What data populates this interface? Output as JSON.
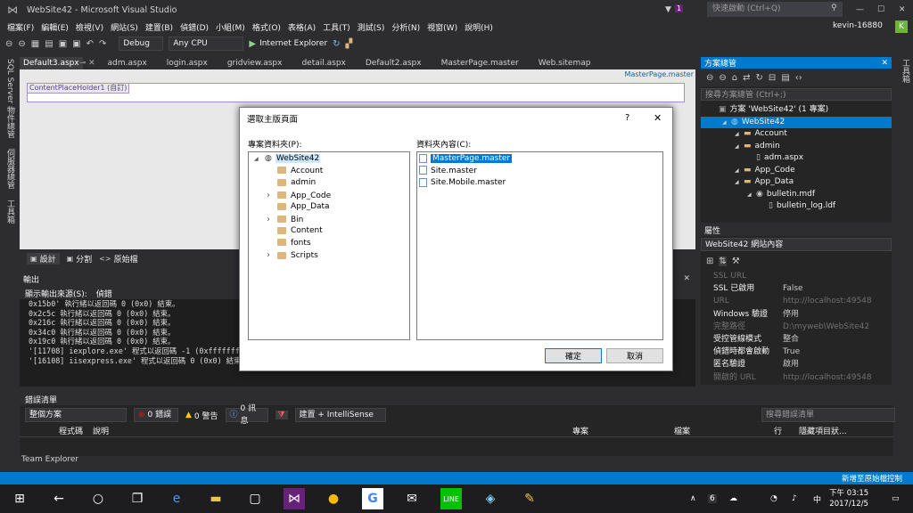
{
  "window": {
    "title": "WebSite42 - Microsoft Visual Studio",
    "notif_count": "1",
    "quick_launch": "快速啟動 (Ctrl+Q)",
    "user": "kevin-16880",
    "avatar_letter": "K"
  },
  "menu": [
    "檔案(F)",
    "編輯(E)",
    "檢視(V)",
    "網站(S)",
    "建置(B)",
    "偵錯(D)",
    "小組(M)",
    "格式(O)",
    "表格(A)",
    "工具(T)",
    "測試(S)",
    "分析(N)",
    "視窗(W)",
    "說明(H)"
  ],
  "toolbar": {
    "config": "Debug",
    "platform": "Any CPU",
    "run_target": "Internet Explorer"
  },
  "left_tabs": [
    "SQL Server 物件總管",
    "伺服器總管",
    "工具箱"
  ],
  "right_tab": "工具箱",
  "doc_tabs": [
    "Default3.aspx",
    "adm.aspx",
    "login.aspx",
    "gridview.aspx",
    "detail.aspx",
    "Default2.aspx",
    "MasterPage.master",
    "Web.sitemap"
  ],
  "editor": {
    "master_label": "MasterPage.master",
    "placeholder_label": "ContentPlaceHolder1 (自訂)"
  },
  "design_tabs": [
    "設計",
    "分割",
    "原始檔"
  ],
  "output": {
    "title": "輸出",
    "source_label": "顯示輸出來源(S):",
    "source_value": "偵錯",
    "lines": [
      "0x15b0' 執行緒以返回碼 0 (0x0) 結束。",
      "0x2c5c 執行緒以返回碼 0 (0x0) 結束。",
      "0x216c 執行緒以返回碼 0 (0x0) 結束。",
      "0x34c0 執行緒以返回碼 0 (0x0) 結束。",
      "0x19c0 執行緒以返回碼 0 (0x0) 結束。",
      "'[11708] iexplore.exe' 程式以返回碼 -1 (0xffffffff) 結",
      "'[16108] iisexpress.exe' 程式以返回碼 0 (0x0) 結束。"
    ]
  },
  "errors": {
    "title": "錯誤清單",
    "scope": "整個方案",
    "errors": "0 錯誤",
    "warnings": "0 警告",
    "messages": "0 訊息",
    "build": "建置 + IntelliSense",
    "search": "搜尋錯誤清單",
    "cols": [
      "程式碼",
      "說明",
      "專案",
      "檔案",
      "行",
      "隱藏項目狀..."
    ]
  },
  "team_explorer": "Team Explorer",
  "status": {
    "right": "新增至原始檔控制"
  },
  "solution": {
    "title": "方案總管",
    "search": "搜尋方案總管 (Ctrl+;)",
    "rows": [
      {
        "t": "方案 'WebSite42' (1 專案)",
        "lvl": 0,
        "sel": false,
        "icon": "solution-icon"
      },
      {
        "t": "WebSite42",
        "lvl": 1,
        "sel": true,
        "icon": "globe-icon"
      },
      {
        "t": "Account",
        "lvl": 2,
        "sel": false,
        "icon": "folder-icon"
      },
      {
        "t": "admin",
        "lvl": 2,
        "sel": false,
        "icon": "folder-icon"
      },
      {
        "t": "adm.aspx",
        "lvl": 3,
        "sel": false,
        "icon": "file-icon"
      },
      {
        "t": "App_Code",
        "lvl": 2,
        "sel": false,
        "icon": "folder-icon"
      },
      {
        "t": "App_Data",
        "lvl": 2,
        "sel": false,
        "icon": "folder-icon"
      },
      {
        "t": "bulletin.mdf",
        "lvl": 3,
        "sel": false,
        "icon": "database-icon"
      },
      {
        "t": "bulletin_log.ldf",
        "lvl": 4,
        "sel": false,
        "icon": "file-icon"
      }
    ]
  },
  "properties": {
    "title": "屬性",
    "object": "WebSite42 網站內容",
    "rows": [
      {
        "k": "SSL URL",
        "v": "",
        "dim": true
      },
      {
        "k": "SSL 已啟用",
        "v": "False",
        "dim": false
      },
      {
        "k": "URL",
        "v": "http://localhost:49548",
        "dim": true
      },
      {
        "k": "Windows 驗證",
        "v": "停用",
        "dim": false
      },
      {
        "k": "完整路徑",
        "v": "D:\\myweb\\WebSite42",
        "dim": true
      },
      {
        "k": "受控管線模式",
        "v": "整合",
        "dim": false
      },
      {
        "k": "偵錯時都會啟動",
        "v": "True",
        "dim": false
      },
      {
        "k": "匿名驗證",
        "v": "啟用",
        "dim": false
      },
      {
        "k": "開啟的 URL",
        "v": "http://localhost:49548",
        "dim": true
      }
    ]
  },
  "dialog": {
    "title": "選取主版頁面",
    "help": "?",
    "close": "✕",
    "folder_label": "專案資料夾(P):",
    "content_label": "資料夾內容(C):",
    "tree": [
      {
        "t": "WebSite42",
        "root": true,
        "exp": false
      },
      {
        "t": "Account",
        "exp": false
      },
      {
        "t": "admin",
        "exp": false
      },
      {
        "t": "App_Code",
        "exp": true
      },
      {
        "t": "App_Data",
        "exp": false
      },
      {
        "t": "Bin",
        "exp": true
      },
      {
        "t": "Content",
        "exp": false
      },
      {
        "t": "fonts",
        "exp": false
      },
      {
        "t": "Scripts",
        "exp": true
      }
    ],
    "files": [
      "MasterPage.master",
      "Site.master",
      "Site.Mobile.master"
    ],
    "ok": "確定",
    "cancel": "取消"
  },
  "taskbar": {
    "time": "下午 03:15",
    "date": "2017/12/5",
    "ime": "中",
    "notif": "6"
  }
}
